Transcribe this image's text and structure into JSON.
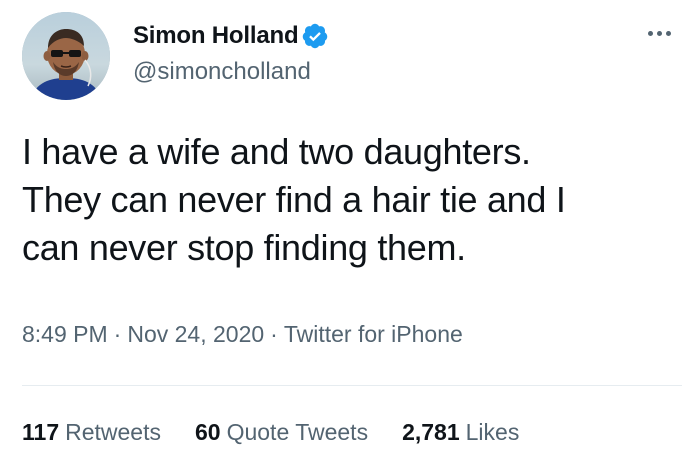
{
  "author": {
    "display_name": "Simon Holland",
    "handle": "@simoncholland",
    "verified": true,
    "verified_color": "#1d9bf0"
  },
  "tweet": {
    "text_lines": [
      "I have a wife and two daughters.",
      "They can never find a hair tie and I",
      "can never stop finding them."
    ]
  },
  "meta": {
    "time": "8:49 PM",
    "separator": "·",
    "date": "Nov 24, 2020",
    "source": "Twitter for iPhone"
  },
  "stats": {
    "retweets": {
      "count": "117",
      "label": "Retweets"
    },
    "quote_tweets": {
      "count": "60",
      "label": "Quote Tweets"
    },
    "likes": {
      "count": "2,781",
      "label": "Likes"
    }
  },
  "icons": {
    "verified": "verified-badge-icon",
    "more": "more-dots-icon"
  }
}
